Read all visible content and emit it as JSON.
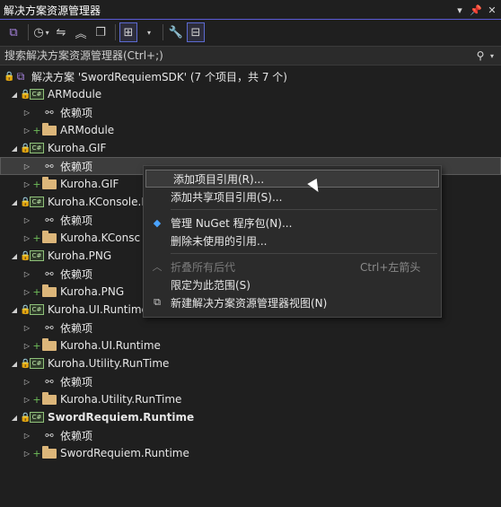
{
  "window": {
    "title": "解决方案资源管理器",
    "pin_icon": "pin-icon",
    "dropdown_icon": "chevron-down-icon",
    "close_icon": "close-icon",
    "accent_color": "#5b5bd6"
  },
  "toolbar": {
    "items": [
      {
        "name": "switch-views-button",
        "icon": "vs-icon"
      },
      {
        "name": "pending-changes-button",
        "icon": "clock-icon"
      },
      {
        "name": "sync-button",
        "icon": "sync-icon"
      },
      {
        "name": "collapse-all-button",
        "icon": "collapse-icon"
      },
      {
        "name": "show-all-files-button",
        "icon": "copy-icon"
      },
      {
        "name": "preview-selected-button",
        "icon": "hierarchy-icon"
      },
      {
        "name": "properties-button",
        "icon": "wrench-icon"
      },
      {
        "name": "preview-button",
        "icon": "preview-icon"
      }
    ]
  },
  "search": {
    "placeholder": "搜索解决方案资源管理器(Ctrl+;)",
    "icon": "search-icon"
  },
  "tree": {
    "solution_label": "解决方案 'SwordRequiemSDK' (7 个项目，共 7 个)",
    "projects": [
      {
        "label": "ARModule",
        "dep": "依赖项",
        "folder": "ARModule"
      },
      {
        "label": "Kuroha.GIF",
        "dep": "依赖项",
        "folder": "Kuroha.GIF"
      },
      {
        "label": "Kuroha.KConsole.R",
        "dep": "依赖项",
        "folder": "Kuroha.KConsc"
      },
      {
        "label": "Kuroha.PNG",
        "dep": "依赖项",
        "folder": "Kuroha.PNG"
      },
      {
        "label": "Kuroha.UI.Runtime",
        "dep": "依赖项",
        "folder": "Kuroha.UI.Runtime"
      },
      {
        "label": "Kuroha.Utility.RunTime",
        "dep": "依赖项",
        "folder": "Kuroha.Utility.RunTime"
      },
      {
        "label": "SwordRequiem.Runtime",
        "dep": "依赖项",
        "folder": "SwordRequiem.Runtime"
      }
    ]
  },
  "context_menu": {
    "add_project_ref": "添加项目引用(R)...",
    "add_shared_ref": "添加共享项目引用(S)...",
    "manage_nuget": "管理 NuGet 程序包(N)...",
    "remove_unused": "删除未使用的引用...",
    "collapse_all": "折叠所有后代",
    "collapse_shortcut": "Ctrl+左箭头",
    "scope_to_this": "限定为此范围(S)",
    "new_view": "新建解决方案资源管理器视图(N)"
  }
}
